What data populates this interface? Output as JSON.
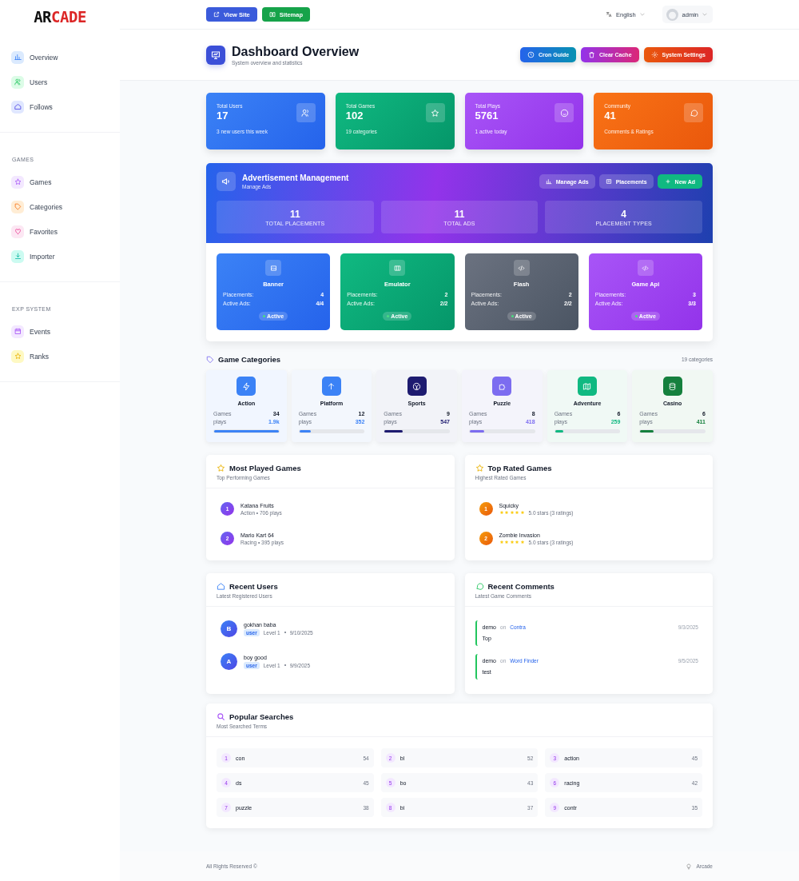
{
  "sidebar": {
    "logo": {
      "part_1": "AR",
      "part_2": "CADE"
    },
    "sections": [
      {
        "items": [
          {
            "label": "Overview"
          },
          {
            "label": "Users"
          },
          {
            "label": "Follows"
          }
        ]
      },
      {
        "heading": "GAMES",
        "items": [
          {
            "label": "Games"
          },
          {
            "label": "Categories"
          },
          {
            "label": "Favorites"
          },
          {
            "label": "Importer"
          }
        ]
      },
      {
        "heading": "EXP SYSTEM",
        "items": [
          {
            "label": "Events"
          },
          {
            "label": "Ranks"
          }
        ]
      }
    ]
  },
  "topbar": {
    "buttons": [
      "View Site",
      "Sitemap"
    ],
    "language": "English",
    "user": "admin"
  },
  "page_header": {
    "title": "Dashboard Overview",
    "subtitle": "System overview and statistics",
    "actions": [
      "Cron Guide",
      "Clear Cache",
      "System Settings"
    ]
  },
  "stats": [
    {
      "label": "Total Users",
      "value": "17",
      "note": "3 new users this week"
    },
    {
      "label": "Total Games",
      "value": "102",
      "note": "19 categories"
    },
    {
      "label": "Total Plays",
      "value": "5761",
      "note": "1 active today"
    },
    {
      "label": "Community",
      "value": "41",
      "note": "Comments & Ratings"
    }
  ],
  "ads": {
    "title": "Advertisement Management",
    "subtitle": "Manage Ads",
    "actions": [
      "Manage Ads",
      "Placements",
      "New Ad"
    ],
    "totals": [
      {
        "value": "11",
        "label": "TOTAL PLACEMENTS"
      },
      {
        "value": "11",
        "label": "TOTAL ADS"
      },
      {
        "value": "4",
        "label": "PLACEMENT TYPES"
      }
    ],
    "types": [
      {
        "name": "Banner",
        "placements_label": "Placements:",
        "placements": "4",
        "active_label": "Active Ads:",
        "active": "4/4",
        "status": "Active"
      },
      {
        "name": "Emulator",
        "placements_label": "Placements:",
        "placements": "2",
        "active_label": "Active Ads:",
        "active": "2/2",
        "status": "Active"
      },
      {
        "name": "Flash",
        "placements_label": "Placements:",
        "placements": "2",
        "active_label": "Active Ads:",
        "active": "2/2",
        "status": "Active"
      },
      {
        "name": "Game Api",
        "placements_label": "Placements:",
        "placements": "3",
        "active_label": "Active Ads:",
        "active": "3/3",
        "status": "Active"
      }
    ]
  },
  "categories": {
    "title": "Game Categories",
    "count": "19 categories",
    "items": [
      {
        "name": "Action",
        "games_label": "Games",
        "games": "34",
        "plays_label": "plays",
        "plays": "1.9k",
        "level": 1.0,
        "color": "#3b82f6"
      },
      {
        "name": "Platform",
        "games_label": "Games",
        "games": "12",
        "plays_label": "plays",
        "plays": "352",
        "level": 0.18,
        "color": "#3b82f6"
      },
      {
        "name": "Sports",
        "games_label": "Games",
        "games": "9",
        "plays_label": "plays",
        "plays": "547",
        "level": 0.28,
        "color": "#1e1b70"
      },
      {
        "name": "Puzzle",
        "games_label": "Games",
        "games": "8",
        "plays_label": "plays",
        "plays": "418",
        "level": 0.22,
        "color": "#7c6cf0"
      },
      {
        "name": "Adventure",
        "games_label": "Games",
        "games": "6",
        "plays_label": "plays",
        "plays": "259",
        "level": 0.13,
        "color": "#10b981"
      },
      {
        "name": "Casino",
        "games_label": "Games",
        "games": "6",
        "plays_label": "plays",
        "plays": "411",
        "level": 0.21,
        "color": "#15803d"
      }
    ]
  },
  "most_played": {
    "title": "Most Played Games",
    "subtitle": "Top Performing Games",
    "items": [
      {
        "rank": "1",
        "name": "Katana Fruits",
        "meta": "Action • 706 plays"
      },
      {
        "rank": "2",
        "name": "Mario Kart 64",
        "meta": "Racing • 395 plays"
      }
    ]
  },
  "top_rated": {
    "title": "Top Rated Games",
    "subtitle": "Highest Rated Games",
    "items": [
      {
        "rank": "1",
        "name": "Squicky",
        "stars": 5,
        "rating": "5.0 stars (3 ratings)"
      },
      {
        "rank": "2",
        "name": "Zombie Invasion",
        "stars": 5,
        "rating": "5.0 stars (3 ratings)"
      }
    ]
  },
  "recent_users": {
    "title": "Recent Users",
    "subtitle": "Latest Registered Users",
    "items": [
      {
        "initial": "B",
        "name": "gokhan baba",
        "role": "user",
        "level": "Level 1",
        "date": "9/10/2025"
      },
      {
        "initial": "A",
        "name": "boy good",
        "role": "user",
        "level": "Level 1",
        "date": "9/9/2025"
      }
    ]
  },
  "recent_comments": {
    "title": "Recent Comments",
    "subtitle": "Latest Game Comments",
    "items": [
      {
        "user": "demo",
        "on": "on",
        "game": "Contra",
        "date": "9/3/2025",
        "text": "Top"
      },
      {
        "user": "demo",
        "on": "on",
        "game": "Word Finder",
        "date": "9/5/2025",
        "text": "test"
      }
    ]
  },
  "popular_searches": {
    "title": "Popular Searches",
    "subtitle": "Most Searched Terms",
    "items": [
      {
        "rank": "1",
        "term": "con",
        "count": "54"
      },
      {
        "rank": "2",
        "term": "bl",
        "count": "52"
      },
      {
        "rank": "3",
        "term": "action",
        "count": "45"
      },
      {
        "rank": "4",
        "term": "ds",
        "count": "45"
      },
      {
        "rank": "5",
        "term": "bo",
        "count": "43"
      },
      {
        "rank": "6",
        "term": "racing",
        "count": "42"
      },
      {
        "rank": "7",
        "term": "puzzle",
        "count": "38"
      },
      {
        "rank": "8",
        "term": "bi",
        "count": "37"
      },
      {
        "rank": "9",
        "term": "contr",
        "count": "35"
      }
    ]
  },
  "footer": {
    "text": "All Rights Reserved ©",
    "brand": "Arcade"
  }
}
